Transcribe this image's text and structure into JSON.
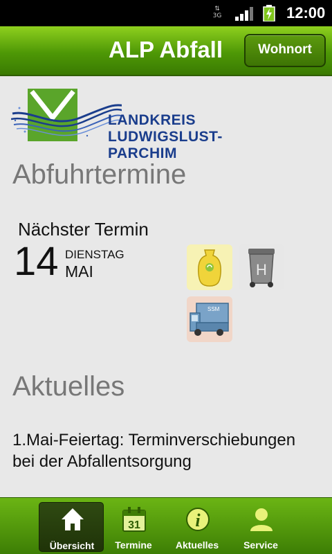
{
  "status_bar": {
    "network": "3G",
    "time": "12:00"
  },
  "app_bar": {
    "title": "ALP Abfall",
    "wohnort_button": "Wohnort"
  },
  "logo": {
    "line1": "LANDKREIS",
    "line2": "LUDWIGSLUST-PARCHIM"
  },
  "abfuhrtermine": {
    "heading": "Abfuhrtermine",
    "next_label": "Nächster Termin",
    "day": "14",
    "weekday": "DIENSTAG",
    "month": "MAI",
    "waste_icons": [
      "gelber-sack-icon",
      "hausmuell-tonne-icon",
      "schadstoffmobil-icon"
    ],
    "hausmuell_letter": "H",
    "ssm_label": "SSM"
  },
  "aktuelles": {
    "heading": "Aktuelles",
    "news_item": "1.Mai-Feiertag: Terminverschiebungen bei der Abfallentsorgung"
  },
  "bottom_nav": {
    "tabs": [
      {
        "label": "Übersicht",
        "icon": "home-icon",
        "active": true
      },
      {
        "label": "Termine",
        "icon": "calendar-icon",
        "calendar_day": "31",
        "active": false
      },
      {
        "label": "Aktuelles",
        "icon": "info-icon",
        "active": false
      },
      {
        "label": "Service",
        "icon": "person-icon",
        "active": false
      }
    ]
  },
  "colors": {
    "accent_green": "#5aa40c",
    "logo_blue": "#1a3d8c",
    "logo_green": "#5aa52a"
  }
}
